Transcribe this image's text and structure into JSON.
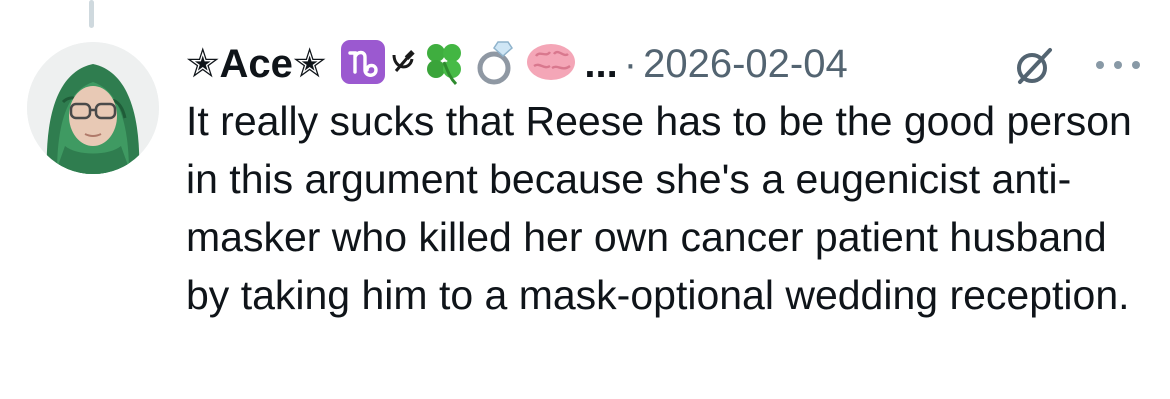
{
  "tweet": {
    "author": {
      "display_name": "✭Ace✭",
      "name_emojis": [
        "capricorn-emoji",
        "hammer-sickle-emoji",
        "four-leaf-clover-emoji",
        "ring-emoji",
        "brain-emoji"
      ],
      "truncation": "..."
    },
    "separator": "·",
    "date": "2026-02-04",
    "icons": {
      "grok": "grok-icon",
      "more": "more-options-icon"
    },
    "text": "It really sucks that Reese has to be the good person in this argument because she's a eugenicist anti-masker who killed her own cancer patient husband by taking him to a mask-optional wedding reception."
  },
  "colors": {
    "text_primary": "#0f1419",
    "text_secondary": "#536471",
    "thread_line": "#cfd9de",
    "capricorn_bg": "#9b59d0",
    "clover": "#3fae3f",
    "brain": "#f4a6b7"
  }
}
